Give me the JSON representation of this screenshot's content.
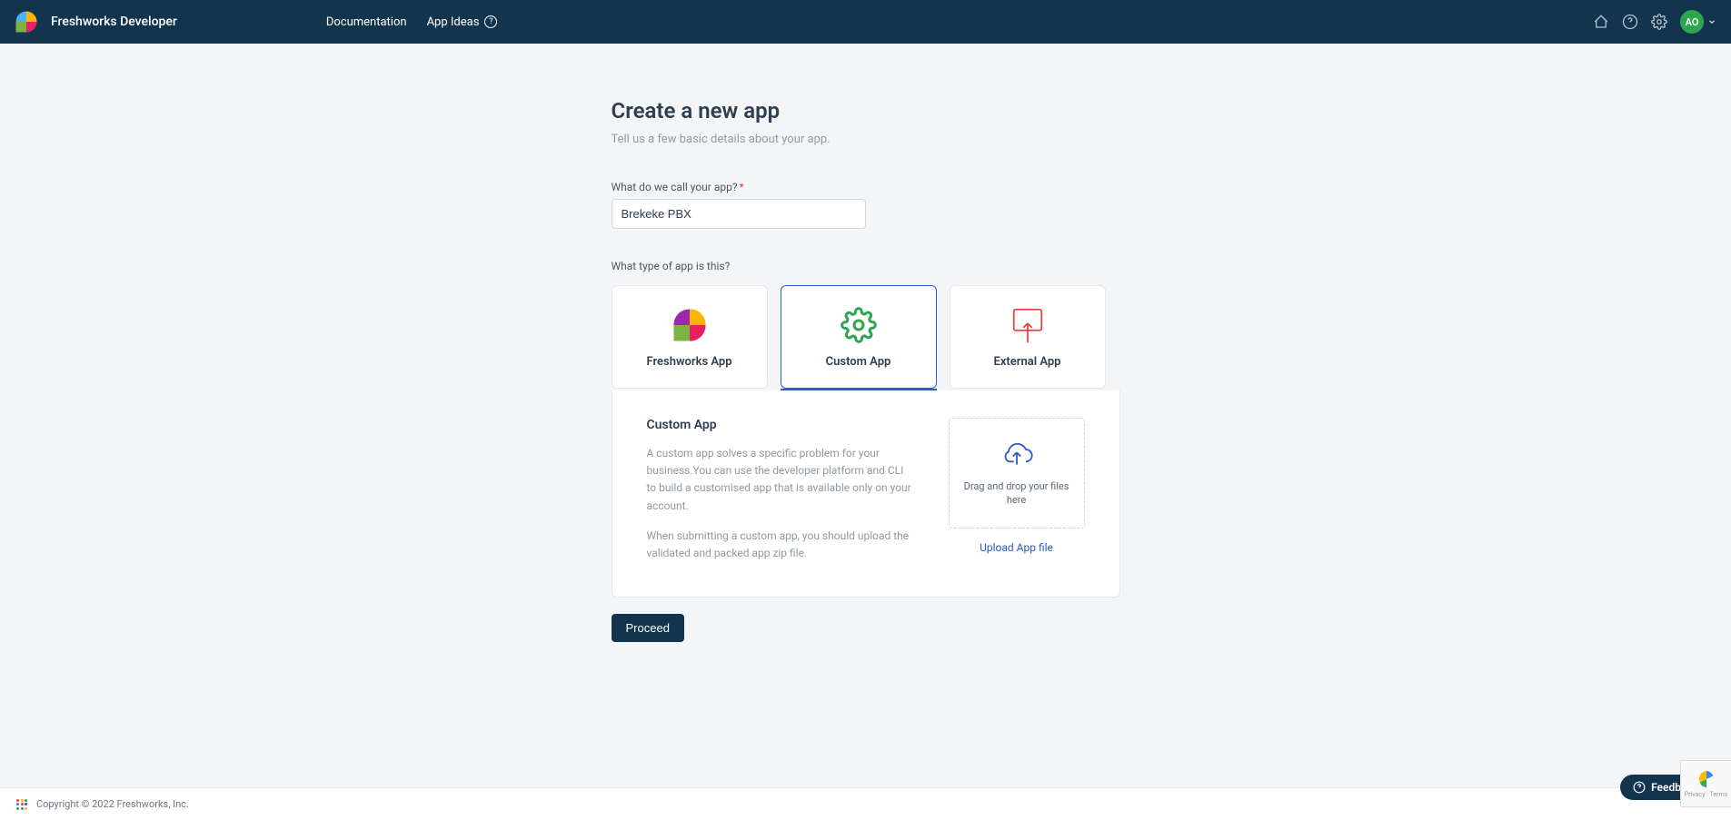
{
  "header": {
    "brand": "Freshworks Developer",
    "nav": {
      "documentation": "Documentation",
      "app_ideas": "App Ideas"
    },
    "avatar_initials": "AO"
  },
  "page": {
    "title": "Create a new app",
    "subtitle": "Tell us a few basic details about your app.",
    "app_name_label": "What do we call your app?",
    "app_name_value": "Brekeke PBX",
    "type_label": "What type of app is this?",
    "types": {
      "freshworks": "Freshworks App",
      "custom": "Custom App",
      "external": "External App"
    },
    "detail": {
      "title": "Custom App",
      "desc1": "A custom app solves a specific problem for your business.You can use the developer platform and CLI to build a customised app that is available only on your account.",
      "desc2": "When submitting a custom app, you should upload the validated and packed app zip file."
    },
    "dropzone_text": "Drag and drop your files here",
    "upload_link": "Upload App file",
    "proceed": "Proceed"
  },
  "footer": {
    "copyright": "Copyright © 2022 Freshworks, Inc."
  },
  "feedback": "Feedback",
  "recaptcha": "Privacy · Terms"
}
